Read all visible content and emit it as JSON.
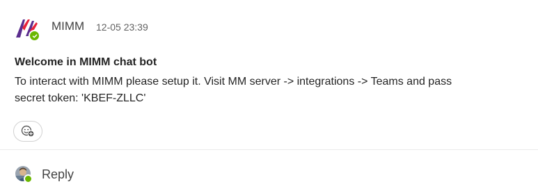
{
  "message": {
    "sender": "MIMM",
    "timestamp": "12-05 23:39",
    "title": "Welcome in MIMM chat bot",
    "body": "To interact with MIMM please setup it. Visit MM server -> integrations -> Teams and pass secret token: 'KBEF-ZLLC'",
    "avatar_icon": "mimm-logo-icon",
    "presence_status": "available",
    "reaction_icon": "add-reaction-icon"
  },
  "reply": {
    "label": "Reply",
    "avatar_icon": "user-avatar"
  },
  "colors": {
    "presence": "#6bb700",
    "logo_purple": "#5b2d8e",
    "logo_red": "#e8233b"
  }
}
